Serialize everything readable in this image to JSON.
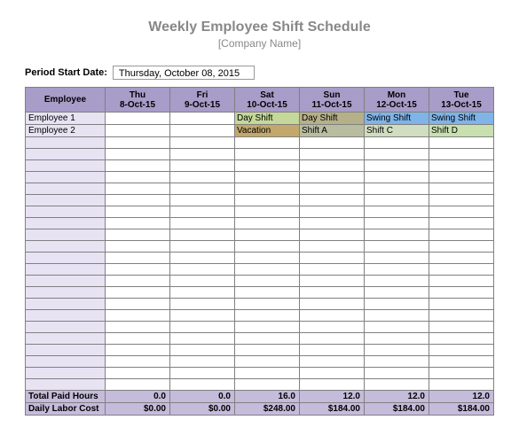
{
  "title": "Weekly Employee Shift Schedule",
  "subtitle": "[Company Name]",
  "period": {
    "label": "Period Start Date:",
    "value": "Thursday, October 08, 2015"
  },
  "headers": {
    "employee": "Employee",
    "days": [
      {
        "dow": "Thu",
        "date": "8-Oct-15"
      },
      {
        "dow": "Fri",
        "date": "9-Oct-15"
      },
      {
        "dow": "Sat",
        "date": "10-Oct-15"
      },
      {
        "dow": "Sun",
        "date": "11-Oct-15"
      },
      {
        "dow": "Mon",
        "date": "12-Oct-15"
      },
      {
        "dow": "Tue",
        "date": "13-Oct-15"
      }
    ]
  },
  "rows": [
    {
      "employee": "Employee 1",
      "cells": [
        "",
        "",
        "Day Shift",
        "Day Shift",
        "Swing Shift",
        "Swing Shift"
      ],
      "styles": [
        "",
        "",
        "shift-day",
        "shift-daylight",
        "shift-swing",
        "shift-swing"
      ]
    },
    {
      "employee": "Employee 2",
      "cells": [
        "",
        "",
        "Vacation",
        "Shift A",
        "Shift C",
        "Shift D"
      ],
      "styles": [
        "",
        "",
        "shift-vacation",
        "shift-a",
        "shift-c",
        "shift-d"
      ]
    }
  ],
  "blank_row_count": 22,
  "totals": {
    "paid_hours": {
      "label": "Total Paid Hours",
      "values": [
        "0.0",
        "0.0",
        "16.0",
        "12.0",
        "12.0",
        "12.0"
      ]
    },
    "labor_cost": {
      "label": "Daily Labor Cost",
      "values": [
        "$0.00",
        "$0.00",
        "$248.00",
        "$184.00",
        "$184.00",
        "$184.00"
      ]
    }
  }
}
